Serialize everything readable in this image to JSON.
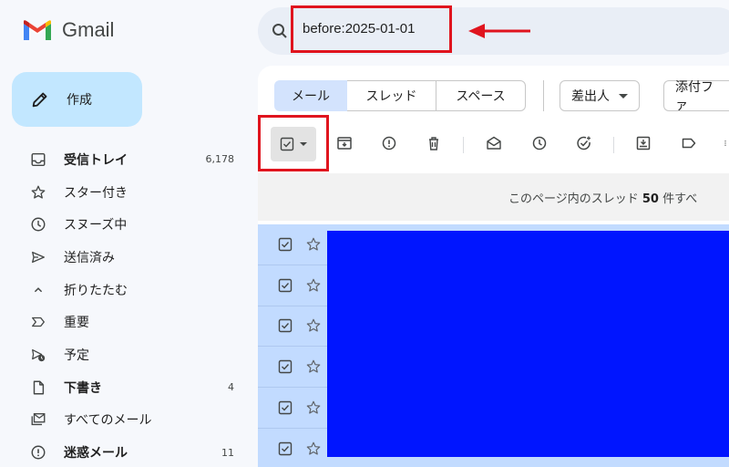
{
  "app": {
    "name": "Gmail"
  },
  "compose": {
    "label": "作成"
  },
  "nav": [
    {
      "label": "受信トレイ",
      "count": "6,178",
      "icon": "inbox-icon",
      "bold": true
    },
    {
      "label": "スター付き",
      "count": "",
      "icon": "star-icon",
      "bold": false
    },
    {
      "label": "スヌーズ中",
      "count": "",
      "icon": "clock-icon",
      "bold": false
    },
    {
      "label": "送信済み",
      "count": "",
      "icon": "send-icon",
      "bold": false
    },
    {
      "label": "折りたたむ",
      "count": "",
      "icon": "chevron-up-icon",
      "bold": false
    },
    {
      "label": "重要",
      "count": "",
      "icon": "important-icon",
      "bold": false
    },
    {
      "label": "予定",
      "count": "",
      "icon": "scheduled-icon",
      "bold": false
    },
    {
      "label": "下書き",
      "count": "4",
      "icon": "draft-icon",
      "bold": true
    },
    {
      "label": "すべてのメール",
      "count": "",
      "icon": "all-mail-icon",
      "bold": false
    },
    {
      "label": "迷惑メール",
      "count": "11",
      "icon": "spam-icon",
      "bold": true
    }
  ],
  "search": {
    "value": "before:2025-01-01"
  },
  "tabs": [
    {
      "label": "メール"
    },
    {
      "label": "スレッド"
    },
    {
      "label": "スペース"
    }
  ],
  "filters": {
    "sender": "差出人",
    "attachment": "添付ファ"
  },
  "banner": {
    "prefix": "このページ内のスレッド ",
    "count": "50",
    "suffix": " 件すべ"
  },
  "colors": {
    "highlight": "#e0141e",
    "selected_row": "#c2dbff",
    "redaction": "#0015ff",
    "compose_bg": "#c2e7ff"
  }
}
